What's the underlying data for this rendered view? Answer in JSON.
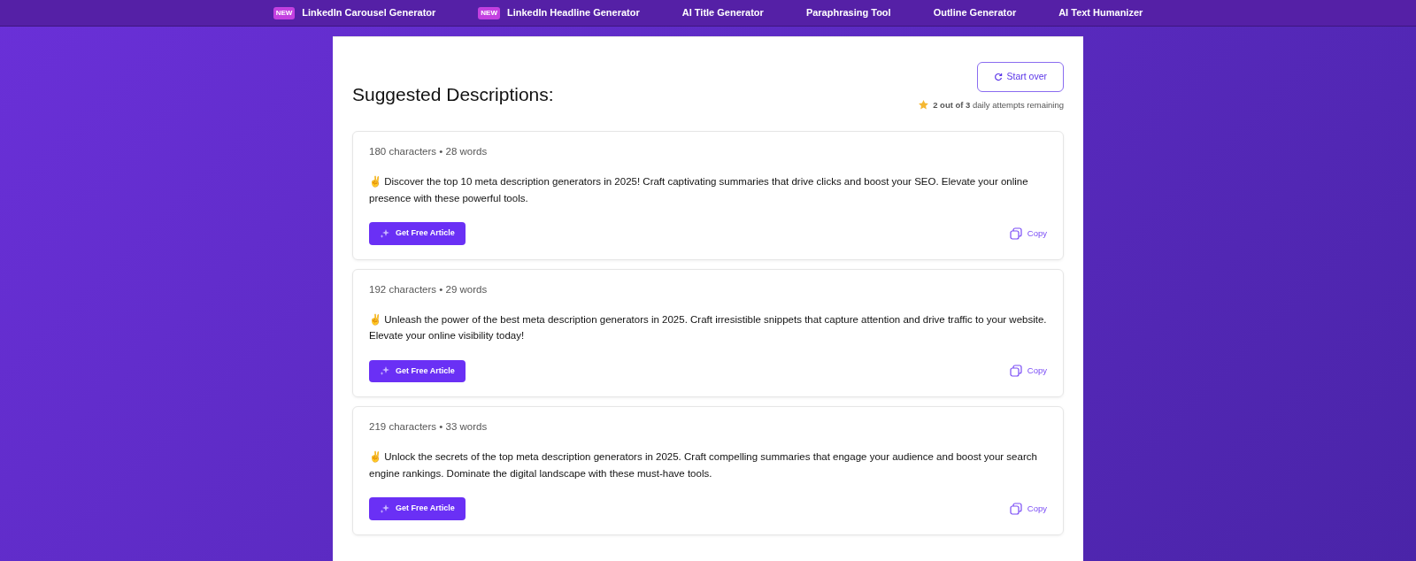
{
  "nav": [
    {
      "label": "LinkedIn Carousel Generator",
      "badge": "NEW"
    },
    {
      "label": "LinkedIn Headline Generator",
      "badge": "NEW"
    },
    {
      "label": "AI Title Generator"
    },
    {
      "label": "Paraphrasing Tool"
    },
    {
      "label": "Outline Generator"
    },
    {
      "label": "AI Text Humanizer"
    }
  ],
  "heading": "Suggested Descriptions:",
  "start_over": "Start over",
  "attempts": "**2 out of 3** daily attempts remaining",
  "results": [
    {
      "stats": "180 characters • 28 words",
      "text": "✌️ Discover the top 10 meta description generators in 2025! Craft captivating summaries that drive clicks and boost your SEO. Elevate your online presence with these powerful tools.",
      "action": "Get Free Article",
      "copy": "Copy"
    },
    {
      "stats": "192 characters • 29 words",
      "text": "✌️ Unleash the power of the best meta description generators in 2025. Craft irresistible snippets that capture attention and drive traffic to your website. Elevate your online visibility today!",
      "action": "Get Free Article",
      "copy": "Copy"
    },
    {
      "stats": "219 characters • 33 words",
      "text": "✌️ Unlock the secrets of the top meta description generators in 2025. Craft compelling summaries that engage your audience and boost your search engine rankings. Dominate the digital landscape with these must-have tools.",
      "action": "Get Free Article",
      "copy": "Copy"
    }
  ]
}
